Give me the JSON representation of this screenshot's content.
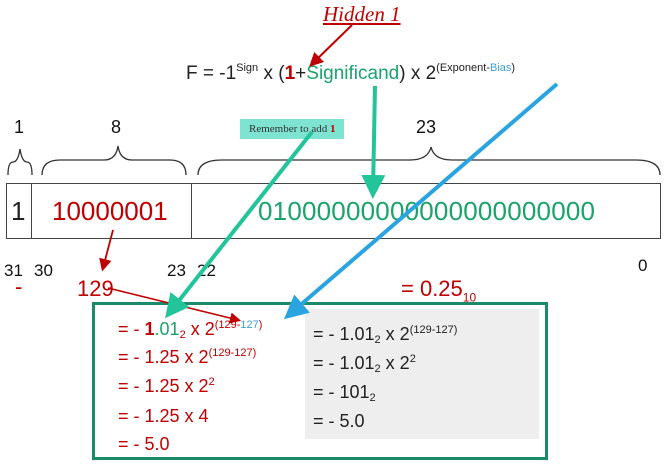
{
  "title": {
    "hidden_label": "Hidden 1"
  },
  "formula": {
    "lhs": "F = -1",
    "sign_sup": "Sign",
    "times1": " x (",
    "one": "1",
    "plus": "+",
    "significand": "Significand",
    "close_times_two": ") x 2",
    "exp_open": "(Exponent-",
    "bias": "Bias",
    "exp_close": ")"
  },
  "note": {
    "prefix": "Remember to add ",
    "one": "1"
  },
  "field_widths": {
    "sign": "1",
    "exponent": "8",
    "mantissa": "23"
  },
  "register": {
    "sign_bit": "1",
    "exponent_bits": "10000001",
    "mantissa_bits": "01000000000000000000000"
  },
  "bit_positions": {
    "p31": "31",
    "p30": "30",
    "p23": "23",
    "p22": "22",
    "p0": "0"
  },
  "sign_value": "-",
  "exponent_value": "129",
  "mantissa_value": {
    "base": "= 0.25",
    "sub": "10"
  },
  "steps_left": {
    "l1": {
      "a": "= - ",
      "one": "1",
      "dot01": ".01",
      "sub": "2",
      "x2": " x 2",
      "sup_open": "(129-",
      "sup_bias": "127",
      "sup_close": ")"
    },
    "l2": {
      "a": "= - 1.25 x 2",
      "sup": "(129-127)"
    },
    "l3": {
      "a": "= - 1.25 x 2",
      "sup": "2"
    },
    "l4": {
      "a": "= - 1.25 x 4"
    },
    "l5": {
      "a": "= - 5.0"
    }
  },
  "steps_right": {
    "r1": {
      "a": "= - 1.01",
      "sub": "2",
      "b": " x 2",
      "sup": "(129-127)"
    },
    "r2": {
      "a": "= - 1.01",
      "sub": "2",
      "b": " x 2",
      "sup": "2"
    },
    "r3": {
      "a": "= - 101",
      "sub": "2"
    },
    "r4": {
      "a": "= - 5.0"
    }
  },
  "colors": {
    "red": "#c00000",
    "green": "#1aa36a",
    "teal_arrow": "#22c49a",
    "blue_arrow": "#2aa4e0",
    "box_border": "#1a8a6a"
  }
}
